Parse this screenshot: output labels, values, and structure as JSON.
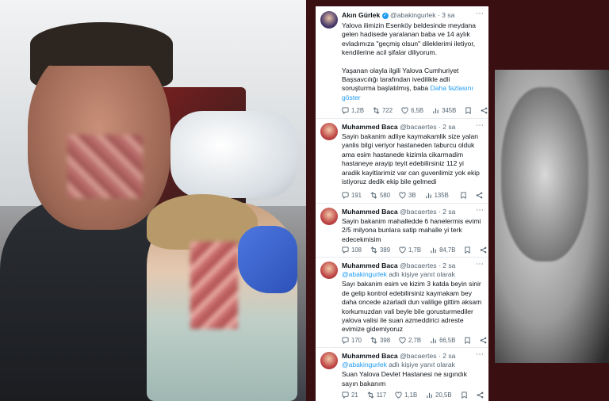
{
  "tweets": [
    {
      "author": "Akın Gürlek",
      "handle": "@abakingurlek",
      "time": "· 3 sa",
      "text1": "Yalova ilimizin Esenköy beldesinde meydana gelen hadisede yaralanan baba ve 14 aylık evladımıza \"geçmiş olsun\" dileklerimi iletiyor, kendilerine acil şifalar diliyorum.",
      "text2": "Yaşanan olayla ilgili Yalova Cumhuriyet Başsavcılığı tarafından ivedilikle adli soruşturma başlatılmış, baba",
      "show_more": "Daha fazlasını göster",
      "replies": "1,2B",
      "retweets": "722",
      "likes": "6,5B",
      "views": "345B"
    },
    {
      "author": "Muhammed Baca",
      "handle": "@bacaertes",
      "time": "· 2 sa",
      "text": "Sayin bakanim adliye kaymakamlik size yalan yanlis bilgi veriyor hastaneden taburcu olduk ama esim hastanede kizimla cikarmadim hastaneye arayip teyit edebilirsiniz 112 yi aradik kayitlarimiz var can guvenlimiz yok ekip istiyoruz dedik ekip bile gelmedi",
      "replies": "191",
      "retweets": "580",
      "likes": "3B",
      "views": "135B"
    },
    {
      "author": "Muhammed Baca",
      "handle": "@bacaertes",
      "time": "· 2 sa",
      "text": "Sayin bakanim mahalledde 6 hanelermis evimi 2/5 milyona bunlara satip mahalle yi terk edecekmisim",
      "replies": "108",
      "retweets": "389",
      "likes": "1,7B",
      "views": "84,7B"
    },
    {
      "author": "Muhammed Baca",
      "handle": "@bacaertes",
      "time": "· 2 sa",
      "reply_handle": "@abakingurlek",
      "reply_suffix": "adlı kişiye yanıt olarak",
      "text": "Sayı bakanim esim ve kizim 3 katda beyin sinir de gelip kontrol edebilirsiniz kaymakam bey daha oncede azarladi dun valilige gittim aksam korkumuzdan vali beyle bile gorusturmediler yalova valisi ile suan azmeddirici adreste evimize gidemiyoruz",
      "replies": "170",
      "retweets": "398",
      "likes": "2,7B",
      "views": "66,5B"
    },
    {
      "author": "Muhammed Baca",
      "handle": "@bacaertes",
      "time": "· 2 sa",
      "reply_handle": "@abakingurlek",
      "reply_suffix": "adlı kişiye yanıt olarak",
      "text": "Suan Yalova Devlet Hastanesi ne sıgındık sayın bakanım",
      "replies": "21",
      "retweets": "117",
      "likes": "1,1B",
      "views": "20,5B"
    }
  ],
  "colors": {
    "accent": "#1d9bf0",
    "text": "#0f1419",
    "muted": "#536471",
    "background": "#3a0f12"
  },
  "icons": [
    "reply-icon",
    "retweet-icon",
    "like-icon",
    "views-icon",
    "bookmark-icon",
    "share-icon",
    "verified-badge-icon",
    "more-icon"
  ]
}
